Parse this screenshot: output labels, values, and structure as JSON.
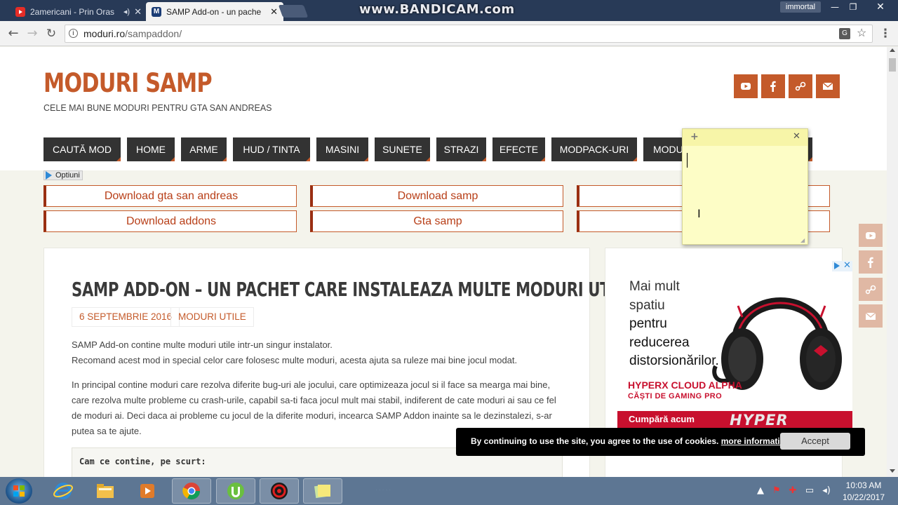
{
  "browser": {
    "tabs": [
      {
        "title": "2americani - Prin Oras",
        "favicon": "youtube-icon"
      },
      {
        "title": "SAMP Add-on - un pache",
        "favicon": "moduri-m-icon"
      }
    ],
    "watermark": "www.BANDICAM.com",
    "profile_name": "immortal",
    "url_host": "moduri.ro",
    "url_path": "/sampaddon/"
  },
  "site": {
    "title": "MODURI SAMP",
    "tagline": "CELE MAI BUNE MODURI PENTRU GTA SAN ANDREAS",
    "social": [
      "youtube-icon",
      "facebook-icon",
      "steam-icon",
      "mail-icon"
    ],
    "accent_color": "#c45a2a"
  },
  "menu": [
    "CAUTĂ MOD",
    "HOME",
    "ARME",
    "HUD / TINTA",
    "MASINI",
    "SUNETE",
    "STRAZI",
    "EFECTE",
    "MODPACK-URI",
    "MODU"
  ],
  "optiuni_label": "Optiuni",
  "downloads": {
    "row1": [
      "Download gta san andreas",
      "Download samp",
      "Do"
    ],
    "row2": [
      "Download addons",
      "Gta samp",
      "Do"
    ]
  },
  "post": {
    "title": "SAMP ADD-ON – UN PACHET CARE INSTALEAZA MULTE MODURI UTILE",
    "date": "6 SEPTEMBRIE 2016",
    "category": "MODURI UTILE",
    "p1_l1": "SAMP Add-on contine multe moduri utile intr-un singur instalator.",
    "p1_l2": "Recomand acest mod in special celor care folosesc multe moduri, acesta ajuta sa ruleze mai bine jocul modat.",
    "p2": "In principal contine moduri care rezolva diferite bug-uri ale jocului, care optimizeaza jocul si il face sa mearga mai bine, care rezolva multe probleme cu crash-urile, capabil sa-ti faca jocul mult mai stabil, indiferent de cate moduri ai sau ce fel de moduri ai. Deci daca ai probleme cu jocul de la diferite moduri, incearca SAMP Addon inainte sa le dezinstalezi, s-ar putea sa te ajute.",
    "code_heading": "Cam ce contine, pe scurt:"
  },
  "ad": {
    "line1": "Mai mult",
    "line2": "spatiu",
    "line3": "pentru",
    "line4": "reducerea",
    "line5": "distorsionărilor.",
    "brand": "HYPERX CLOUD ALPHA",
    "subtitle": "CĂȘTI DE GAMING PRO",
    "cta": "Cumpără acum",
    "logo": "HYPER"
  },
  "cookie": {
    "text": "By continuing to use the site, you agree to the use of cookies.",
    "link": "more information",
    "accept": "Accept"
  },
  "taskbar": {
    "time": "10:03 AM",
    "date": "10/22/2017"
  }
}
